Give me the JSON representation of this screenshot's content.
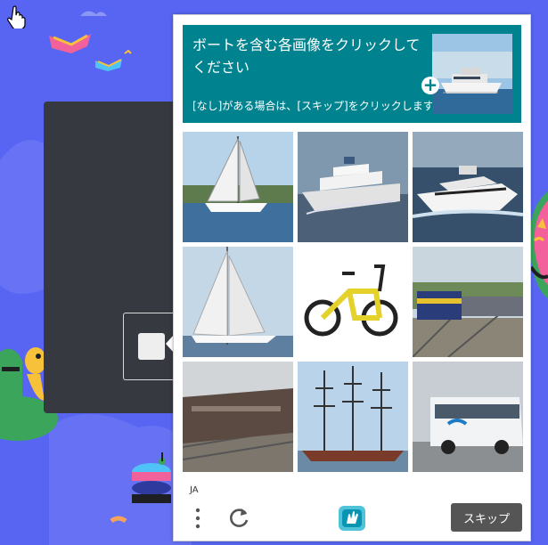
{
  "captcha": {
    "prompt": "ボートを含む各画像をクリックしてください",
    "sub_instruction": "[なし]がある場合は、[スキップ]をクリックします",
    "sample_plus": "+",
    "language": "JA",
    "skip_label": "スキップ",
    "accent_color": "#00838f",
    "grid": [
      {
        "subject": "sailboat"
      },
      {
        "subject": "cruise-ship"
      },
      {
        "subject": "motor-yacht"
      },
      {
        "subject": "sailboat-sails"
      },
      {
        "subject": "yellow-bicycle"
      },
      {
        "subject": "train"
      },
      {
        "subject": "train"
      },
      {
        "subject": "tall-ship"
      },
      {
        "subject": "coach-bus"
      }
    ]
  },
  "background": {
    "color": "#5865f2",
    "tooltip_icon": "square-icon"
  }
}
